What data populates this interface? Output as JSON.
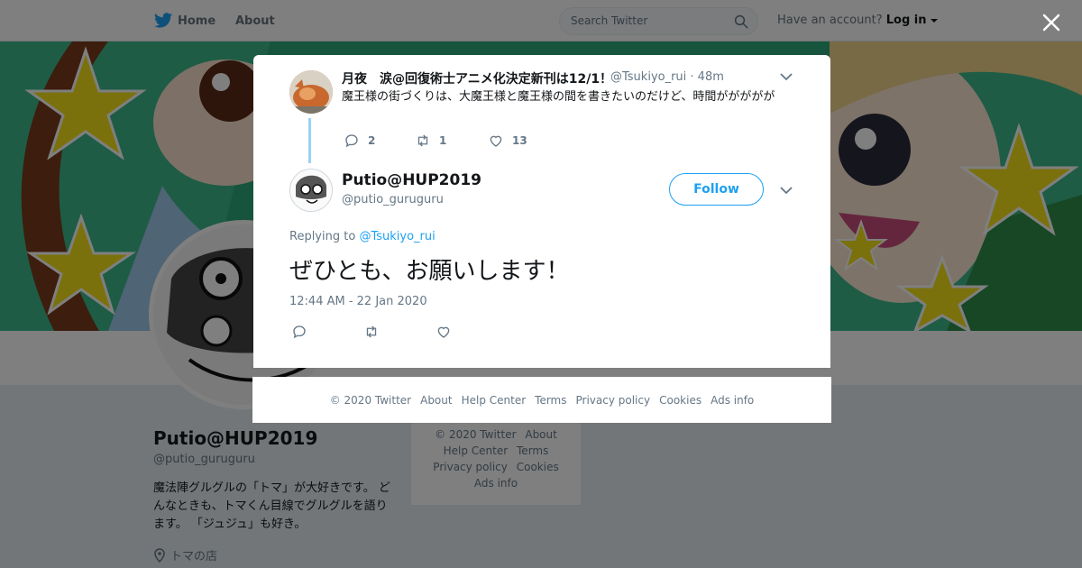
{
  "topbar": {
    "home_label": "Home",
    "about_label": "About",
    "search_placeholder": "Search Twitter",
    "have_account": "Have an account?",
    "login_label": "Log in"
  },
  "profile": {
    "name": "Putio@HUP2019",
    "handle": "@putio_guruguru",
    "bio": "魔法陣グルグルの「トマ」が大好きです。 どんなときも、トマくん目線でグルグルを語ります。 「ジュジュ」も好き。",
    "location": "トマの店"
  },
  "side_footer": {
    "copyright": "© 2020 Twitter",
    "about": "About",
    "help": "Help Center",
    "terms": "Terms",
    "privacy": "Privacy policy",
    "cookies": "Cookies",
    "ads": "Ads info"
  },
  "parent_tweet": {
    "name": "月夜　涙@回復術士アニメ化決定新刊は12/1！",
    "handle_time": "@Tsukiyo_rui · 48m",
    "text": "魔王様の街づくりは、大魔王様と魔王様の間を書きたいのだけど、時間ががががが",
    "replies": "2",
    "retweets": "1",
    "likes": "13"
  },
  "main_tweet": {
    "name": "Putio@HUP2019",
    "handle": "@putio_guruguru",
    "follow_label": "Follow",
    "replying_prefix": "Replying to",
    "replying_to": "@Tsukiyo_rui",
    "text": "ぜひとも、お願いします！",
    "timestamp": "12:44 AM - 22 Jan 2020"
  },
  "modal_footer": {
    "copyright": "© 2020 Twitter",
    "about": "About",
    "help": "Help Center",
    "terms": "Terms",
    "privacy": "Privacy policy",
    "cookies": "Cookies",
    "ads": "Ads info"
  },
  "colors": {
    "accent": "#1da1f2",
    "banner_green": "#2ea87a",
    "star_yellow": "#f5e21a"
  },
  "icons": [
    "twitter-bird-icon",
    "search-icon",
    "caret-down-icon",
    "close-icon",
    "reply-icon",
    "retweet-icon",
    "like-icon",
    "location-pin-icon"
  ]
}
